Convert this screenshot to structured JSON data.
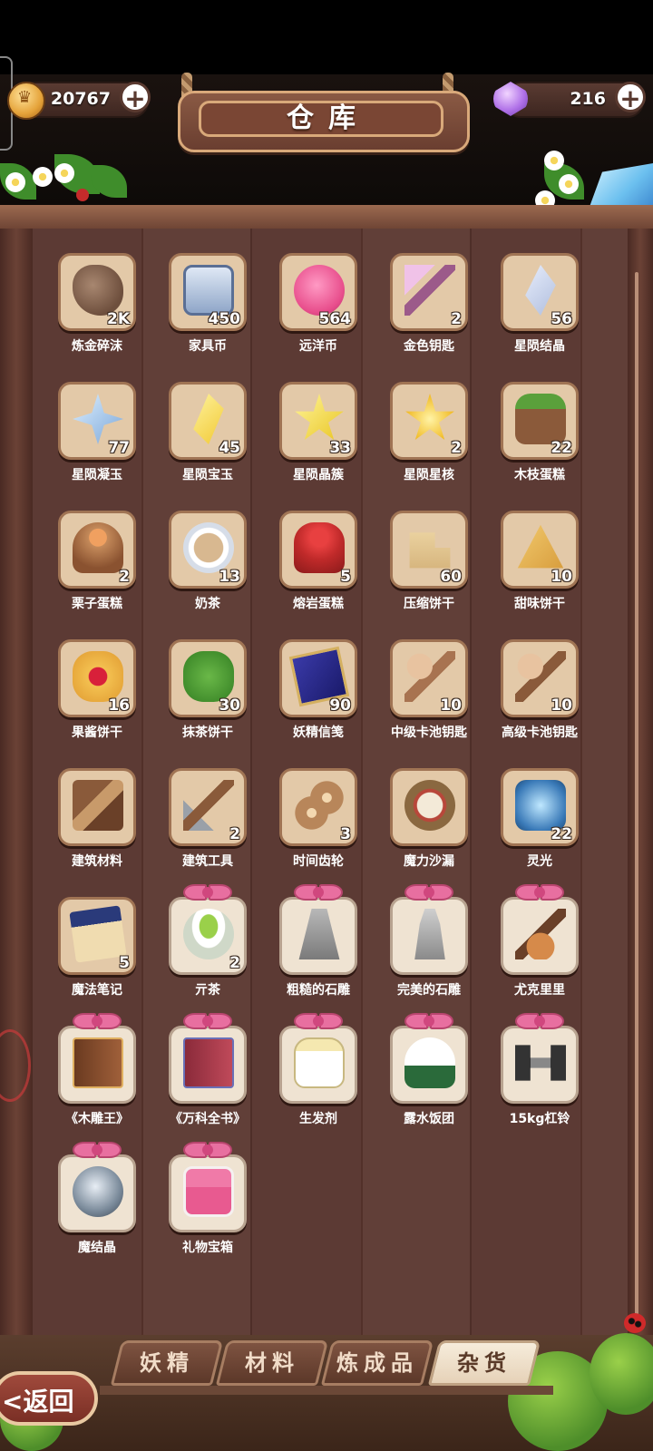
{
  "header": {
    "title": "仓库",
    "gold": {
      "value": "20767",
      "plus": "+",
      "icon": "gold-coin-icon"
    },
    "gems": {
      "value": "216",
      "plus": "+",
      "icon": "gem-icon"
    }
  },
  "items": [
    {
      "name": "炼金碎沫",
      "count": "2K",
      "icon": "alchemy-crumbs-icon"
    },
    {
      "name": "家具币",
      "count": "450",
      "icon": "furniture-coin-icon"
    },
    {
      "name": "远洋币",
      "count": "564",
      "icon": "ocean-coin-icon"
    },
    {
      "name": "金色钥匙",
      "count": "2",
      "icon": "gold-key-icon"
    },
    {
      "name": "星陨结晶",
      "count": "56",
      "icon": "star-crystal-icon"
    },
    {
      "name": "星陨凝玉",
      "count": "77",
      "icon": "star-jade-icon"
    },
    {
      "name": "星陨宝玉",
      "count": "45",
      "icon": "star-gem-icon"
    },
    {
      "name": "星陨晶簇",
      "count": "33",
      "icon": "star-cluster-icon"
    },
    {
      "name": "星陨星核",
      "count": "2",
      "icon": "star-core-icon"
    },
    {
      "name": "木枝蛋糕",
      "count": "22",
      "icon": "log-cake-icon"
    },
    {
      "name": "栗子蛋糕",
      "count": "2",
      "icon": "chestnut-cake-icon"
    },
    {
      "name": "奶茶",
      "count": "13",
      "icon": "milk-tea-icon"
    },
    {
      "name": "熔岩蛋糕",
      "count": "5",
      "icon": "lava-cake-icon"
    },
    {
      "name": "压缩饼干",
      "count": "60",
      "icon": "compressed-biscuit-icon"
    },
    {
      "name": "甜味饼干",
      "count": "10",
      "icon": "sweet-cracker-icon"
    },
    {
      "name": "果酱饼干",
      "count": "16",
      "icon": "jam-cookie-icon"
    },
    {
      "name": "抹茶饼干",
      "count": "30",
      "icon": "matcha-cookie-icon"
    },
    {
      "name": "妖精信笺",
      "count": "90",
      "icon": "fairy-letter-icon"
    },
    {
      "name": "中级卡池钥匙",
      "count": "10",
      "icon": "mid-pool-key-icon"
    },
    {
      "name": "高级卡池钥匙",
      "count": "10",
      "icon": "high-pool-key-icon"
    },
    {
      "name": "建筑材料",
      "count": "",
      "icon": "building-material-icon"
    },
    {
      "name": "建筑工具",
      "count": "2",
      "icon": "building-tools-icon"
    },
    {
      "name": "时间齿轮",
      "count": "3",
      "icon": "time-gear-icon"
    },
    {
      "name": "魔力沙漏",
      "count": "",
      "icon": "magic-hourglass-icon"
    },
    {
      "name": "灵光",
      "count": "22",
      "icon": "inspiration-icon"
    },
    {
      "name": "魔法笔记",
      "count": "5",
      "icon": "magic-notebook-icon"
    },
    {
      "name": "亓茶",
      "count": "2",
      "icon": "tea-bowl-icon"
    },
    {
      "name": "粗糙的石雕",
      "count": "",
      "icon": "rough-statue-icon"
    },
    {
      "name": "完美的石雕",
      "count": "",
      "icon": "perfect-statue-icon"
    },
    {
      "name": "尤克里里",
      "count": "",
      "icon": "ukulele-icon"
    },
    {
      "name": "《木雕王》",
      "count": "",
      "icon": "brown-book-icon"
    },
    {
      "name": "《万科全书》",
      "count": "",
      "icon": "red-book-icon"
    },
    {
      "name": "生发剂",
      "count": "",
      "icon": "hair-tonic-icon"
    },
    {
      "name": "露水饭团",
      "count": "",
      "icon": "rice-ball-icon"
    },
    {
      "name": "15kg杠铃",
      "count": "",
      "icon": "dumbbell-icon"
    },
    {
      "name": "魔结晶",
      "count": "",
      "icon": "magic-crystal-icon"
    },
    {
      "name": "礼物宝箱",
      "count": "",
      "icon": "gift-chest-icon"
    }
  ],
  "tabs": [
    {
      "label": "妖精"
    },
    {
      "label": "材料"
    },
    {
      "label": "炼成品"
    },
    {
      "label": "杂货"
    }
  ],
  "active_tab": "杂货",
  "back": {
    "label": "<返回"
  }
}
